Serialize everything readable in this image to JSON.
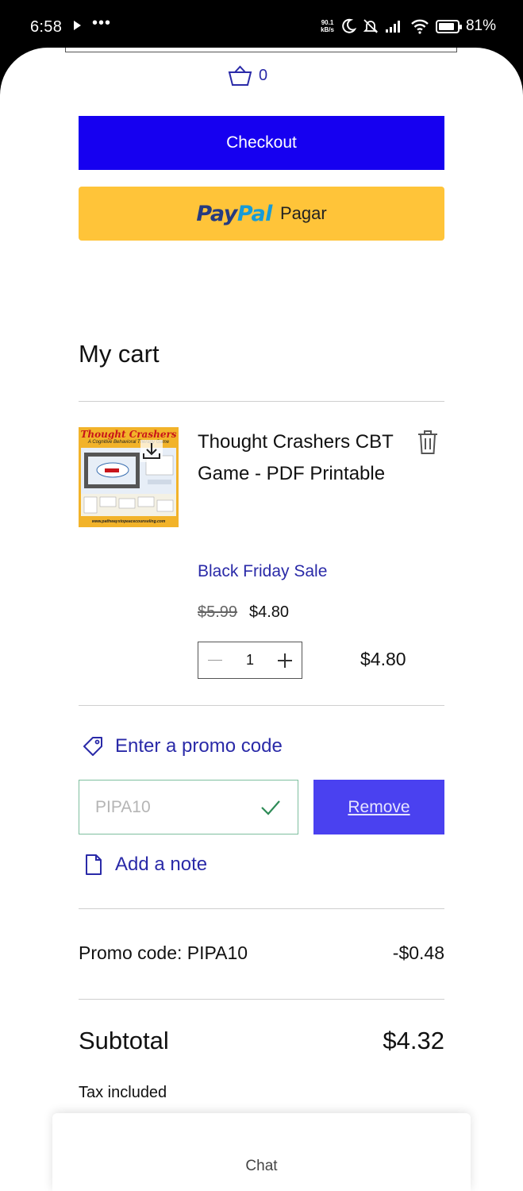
{
  "status_bar": {
    "time": "6:58",
    "dots": "•••",
    "net_speed_value": "90.1",
    "net_speed_unit": "kB/s",
    "battery": "81%"
  },
  "header": {
    "cart_count": "0"
  },
  "buttons": {
    "checkout": "Checkout",
    "paypal_pay": "Pay",
    "paypal_pal": "Pal",
    "paypal_label": "Pagar"
  },
  "cart": {
    "title": "My cart",
    "item": {
      "name": "Thought Crashers CBT Game - PDF Printable",
      "promo_label": "Black Friday Sale",
      "original_price": "$5.99",
      "sale_price": "$4.80",
      "quantity": "1",
      "line_total": "$4.80",
      "thumbnail": {
        "title": "Thought Crashers",
        "subtitle": "A Cognitive Behavioral Therapy Game",
        "footer": "www.pathwaystopeacecounseling.com"
      }
    }
  },
  "promo": {
    "link": "Enter a promo code",
    "code_value": "PIPA10",
    "remove": "Remove"
  },
  "note": {
    "link": "Add a note"
  },
  "summary": {
    "promo_line": "Promo code: PIPA10",
    "promo_discount": "-$0.48",
    "subtotal_label": "Subtotal",
    "subtotal_value": "$4.32",
    "tax_note": "Tax included"
  },
  "chat": {
    "label": "Chat"
  },
  "colors": {
    "checkout_bg": "#1600f0",
    "paypal_bg": "#ffc439",
    "link": "#2a2aa8",
    "remove_bg": "#4a41f0"
  }
}
